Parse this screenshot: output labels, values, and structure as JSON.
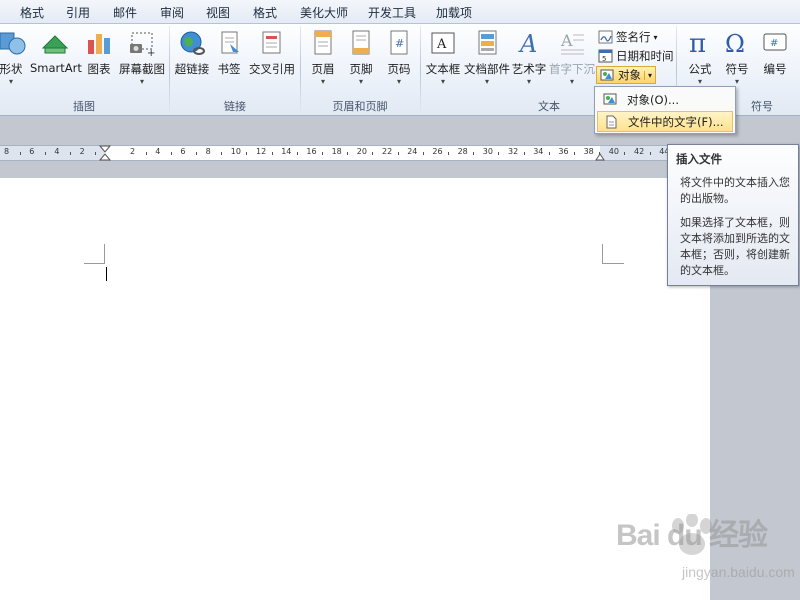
{
  "tabs": [
    "格式",
    "引用",
    "邮件",
    "审阅",
    "视图",
    "格式",
    "美化大师",
    "开发工具",
    "加载项"
  ],
  "ribbon": {
    "groups": {
      "illustrations": "插图",
      "links": "链接",
      "header_footer": "页眉和页脚",
      "text": "文本",
      "symbols_partial": "符号"
    },
    "buttons": {
      "shapes": "形状",
      "smartart": "SmartArt",
      "chart": "图表",
      "screenshot": "屏幕截图",
      "hyperlink": "超链接",
      "bookmark": "书签",
      "cross_reference": "交叉引用",
      "header": "页眉",
      "footer": "页脚",
      "page_number": "页码",
      "text_box": "文本框",
      "quick_parts": "文档部件",
      "wordart": "艺术字",
      "drop_cap": "首字下沉",
      "signature_line": "签名行",
      "date_time": "日期和时间",
      "object": "对象",
      "equation": "公式",
      "symbol": "符号",
      "numbering": "编号"
    }
  },
  "dropdown": {
    "items": [
      "对象(O)...",
      "文件中的文字(F)..."
    ]
  },
  "tooltip": {
    "title": "插入文件",
    "p1": "将文件中的文本插入您的出版物。",
    "p2": "如果选择了文本框，则文本将添加到所选的文本框；否则，将创建新的文本框。"
  },
  "ruler": {
    "labels": [
      "8",
      "6",
      "4",
      "2",
      "2",
      "4",
      "6",
      "8",
      "10",
      "12",
      "14",
      "16",
      "18",
      "20",
      "22",
      "24",
      "26",
      "28",
      "30",
      "32",
      "34",
      "36",
      "38",
      "40",
      "42",
      "44"
    ]
  },
  "watermark": {
    "main": "Bai du 经验",
    "sub": "jingyan.baidu.com"
  },
  "colors": {
    "ribbon_bg": "#eef3fa",
    "highlight": "#ffd466",
    "page": "#ffffff",
    "workspace": "#c3c8d0"
  }
}
